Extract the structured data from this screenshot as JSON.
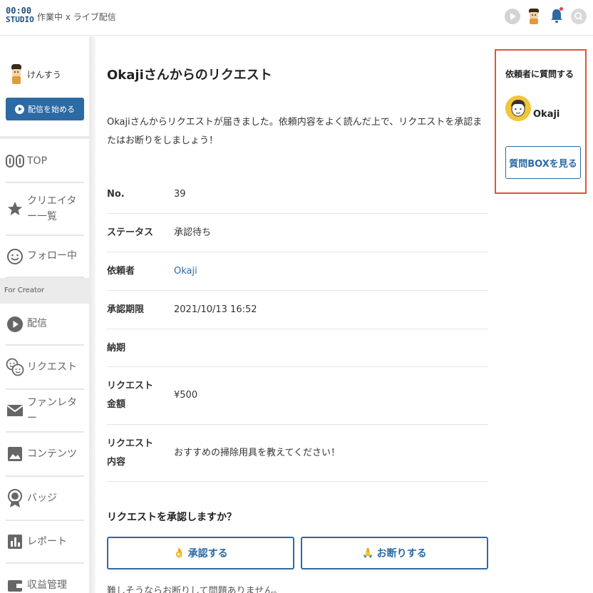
{
  "header": {
    "logo_line1": "00:00",
    "logo_line2": "STUDIO",
    "subtitle": "作業中 x ライブ配信"
  },
  "sidebar": {
    "user_name": "けんすう",
    "start_stream_label": "配信を始める",
    "section_label": "For Creator",
    "items": [
      {
        "label": "TOP",
        "icon": "toppage-icon"
      },
      {
        "label": "クリエイター一覧",
        "icon": "star-icon"
      },
      {
        "label": "フォロー中",
        "icon": "smiley-icon"
      },
      {
        "label": "配信",
        "icon": "play-circle-icon"
      },
      {
        "label": "リクエスト",
        "icon": "faces-icon"
      },
      {
        "label": "ファンレター",
        "icon": "envelope-icon"
      },
      {
        "label": "コンテンツ",
        "icon": "image-icon"
      },
      {
        "label": "バッジ",
        "icon": "badge-icon"
      },
      {
        "label": "レポート",
        "icon": "bar-chart-icon"
      },
      {
        "label": "収益管理",
        "icon": "wallet-icon"
      }
    ]
  },
  "main": {
    "title": "Okajiさんからのリクエスト",
    "intro": "Okajiさんからリクエストが届きました。依頼内容をよく読んだ上で、リクエストを承認またはお断りをしましょう！",
    "rows": [
      {
        "key": "No.",
        "value": "39"
      },
      {
        "key": "ステータス",
        "value": "承認待ち"
      },
      {
        "key": "依頼者",
        "value": "Okaji"
      },
      {
        "key": "承認期限",
        "value": "2021/10/13 16:52"
      },
      {
        "key": "納期",
        "value": ""
      },
      {
        "key": "リクエスト金額",
        "value": "¥500"
      },
      {
        "key": "リクエスト内容",
        "value": "おすすめの掃除用具を教えてください！"
      }
    ],
    "confirm_question": "リクエストを承認しますか？",
    "approve_label": "承認する",
    "decline_label": "お断りする",
    "approve_emoji": "👌",
    "decline_emoji": "🙏",
    "note": "難しそうならお断りして問題ありません。"
  },
  "ask_panel": {
    "title": "依頼者に質問する",
    "name": "Okaji",
    "button_label": "質問BOXを見る"
  },
  "colors": {
    "accent": "#2c6aa4",
    "highlight_border": "#e3533a",
    "avatar_bg": "#f2c53a"
  }
}
